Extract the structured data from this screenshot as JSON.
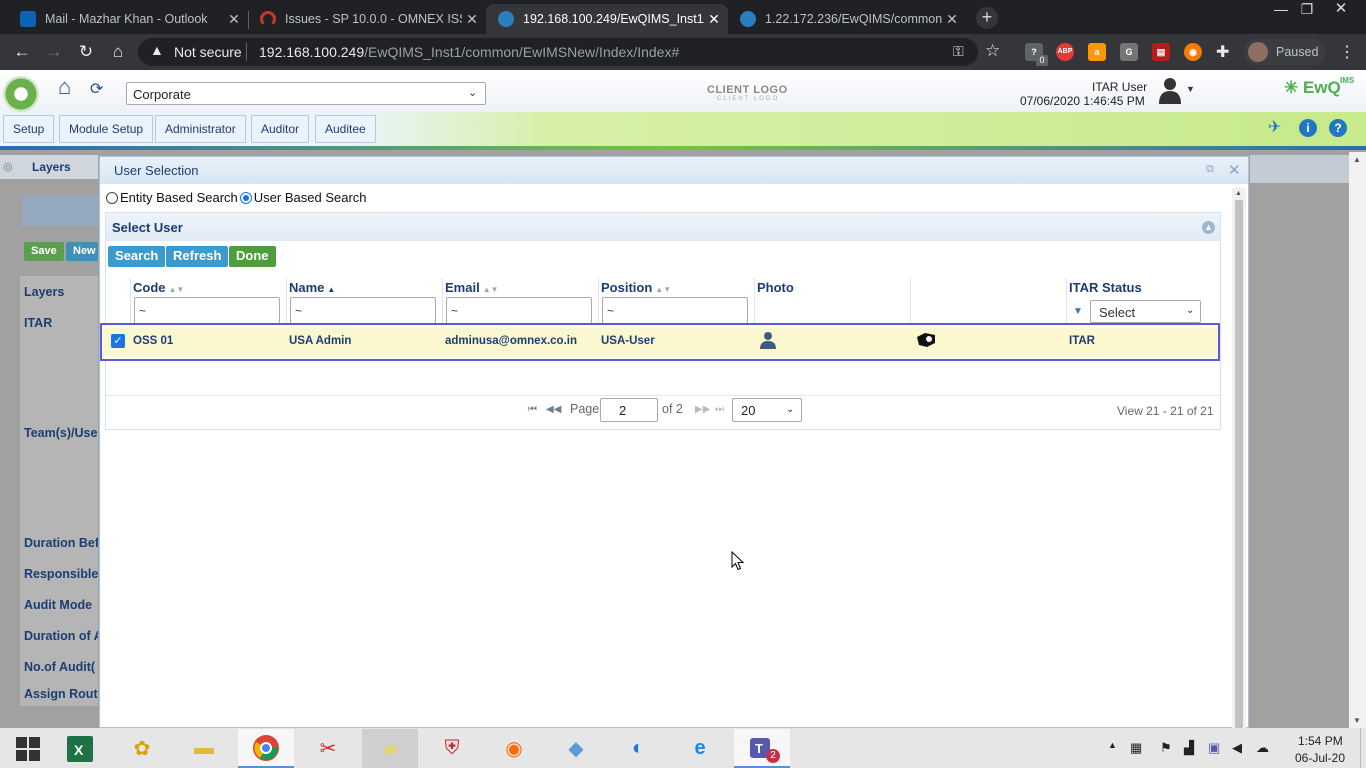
{
  "browser": {
    "tabs": [
      {
        "title": "Mail - Mazhar Khan - Outlook",
        "active": false,
        "favicon_color": "#0a64b4"
      },
      {
        "title": "Issues - SP 10.0.0 - OMNEX ISSUE",
        "active": false,
        "favicon_color": "#c0392b"
      },
      {
        "title": "192.168.100.249/EwQIMS_Inst1/c",
        "active": true,
        "favicon_color": "#2b7fc1"
      },
      {
        "title": "1.22.172.236/EwQIMS/common/",
        "active": false,
        "favicon_color": "#2b7fc1"
      }
    ],
    "new_tab": "+",
    "security_label": "Not secure",
    "url_host": "192.168.100.249",
    "url_path": "/EwQIMS_Inst1/common/EwIMSNew/Index/Index#",
    "profile_status": "Paused",
    "extensions": [
      "key-icon",
      "star-icon",
      "question-ext-icon",
      "abp-icon",
      "amazon-icon",
      "g-icon",
      "pdf-icon",
      "firefox-ext-icon",
      "puzzle-icon"
    ],
    "abp_label": "ABP",
    "ext_badge": "0"
  },
  "app": {
    "business_unit": "Corporate",
    "client_logo": "CLIENT LOGO",
    "client_logo_sub": "CLIENT LOGO",
    "user_name": "ITAR User",
    "datetime": "07/06/2020 1:46:45 PM",
    "brand": "EwQ",
    "brand_suffix": "IMS",
    "menu": [
      "Setup",
      "Module Setup",
      "Administrator",
      "Auditor",
      "Auditee"
    ]
  },
  "background_page": {
    "breadcrumb": "Layers",
    "save_label": "Save",
    "new_label": "New",
    "form_labels": [
      "Layers",
      "ITAR",
      "Team(s)/Use",
      "Duration Bef",
      "Responsible",
      "Audit Mode",
      "Duration of A",
      "No.of Audit(",
      "Assign Route"
    ]
  },
  "dialog": {
    "title": "User Selection",
    "search_modes": [
      "Entity Based Search",
      "User Based Search"
    ],
    "selected_mode": "User Based Search",
    "panel_title": "Select User",
    "buttons": {
      "search": "Search",
      "refresh": "Refresh",
      "done": "Done"
    },
    "columns": [
      "Code",
      "Name",
      "Email",
      "Position",
      "Photo",
      "",
      "ITAR Status"
    ],
    "filters": {
      "code": "~",
      "name": "~",
      "email": "~",
      "position": "~",
      "itar_status": "Select"
    },
    "rows": [
      {
        "checked": true,
        "code": "OSS 01",
        "name": "USA Admin",
        "email": "adminusa@omnex.co.in",
        "position": "USA-User",
        "photo_icon": "user-photo-icon",
        "badge_icon": "itar-badge-icon",
        "itar_status": "ITAR"
      }
    ],
    "pager": {
      "page_label": "Page",
      "page": "2",
      "of_label": "of 2",
      "page_size": "20",
      "view_text": "View 21 - 21 of 21"
    }
  },
  "taskbar": {
    "apps": [
      "windows-start-icon",
      "excel-icon",
      "app-flower-icon",
      "file-explorer-icon",
      "chrome-icon",
      "snipping-tool-icon",
      "sticky-notes-icon",
      "security-shield-icon",
      "firefox-icon",
      "remote-desktop-icon",
      "edge-icon",
      "internet-explorer-icon",
      "teams-icon"
    ],
    "teams_badge": "2",
    "time": "1:54 PM",
    "date": "06-Jul-20"
  }
}
